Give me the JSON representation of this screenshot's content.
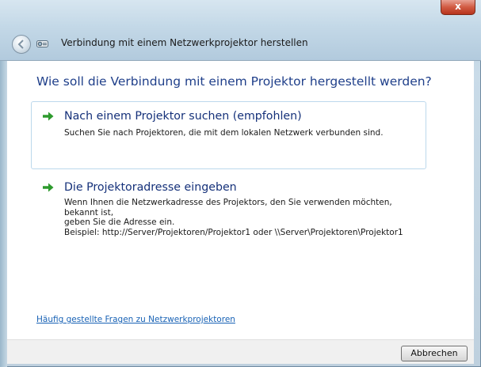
{
  "window": {
    "close_label": "x",
    "title": "Verbindung mit einem Netzwerkprojektor herstellen"
  },
  "main": {
    "heading": "Wie soll die Verbindung mit einem Projektor hergestellt werden?",
    "options": [
      {
        "title": "Nach einem Projektor suchen (empfohlen)",
        "description_lines": [
          "Suchen Sie nach Projektoren, die mit dem lokalen Netzwerk verbunden sind."
        ]
      },
      {
        "title": "Die Projektoradresse eingeben",
        "description_lines": [
          "Wenn Ihnen die Netzwerkadresse des Projektors, den Sie verwenden möchten, bekannt ist,",
          "geben Sie die Adresse ein.",
          "Beispiel: http://Server/Projektoren/Projektor1 oder \\\\Server\\Projektoren\\Projektor1"
        ]
      }
    ],
    "faq_link": "Häufig gestellte Fragen zu Netzwerkprojektoren"
  },
  "footer": {
    "cancel_label": "Abbrechen"
  },
  "colors": {
    "accent": "#1f3f8a",
    "arrow": "#2d9a2d",
    "link": "#1862b5",
    "close": "#c84a32"
  }
}
